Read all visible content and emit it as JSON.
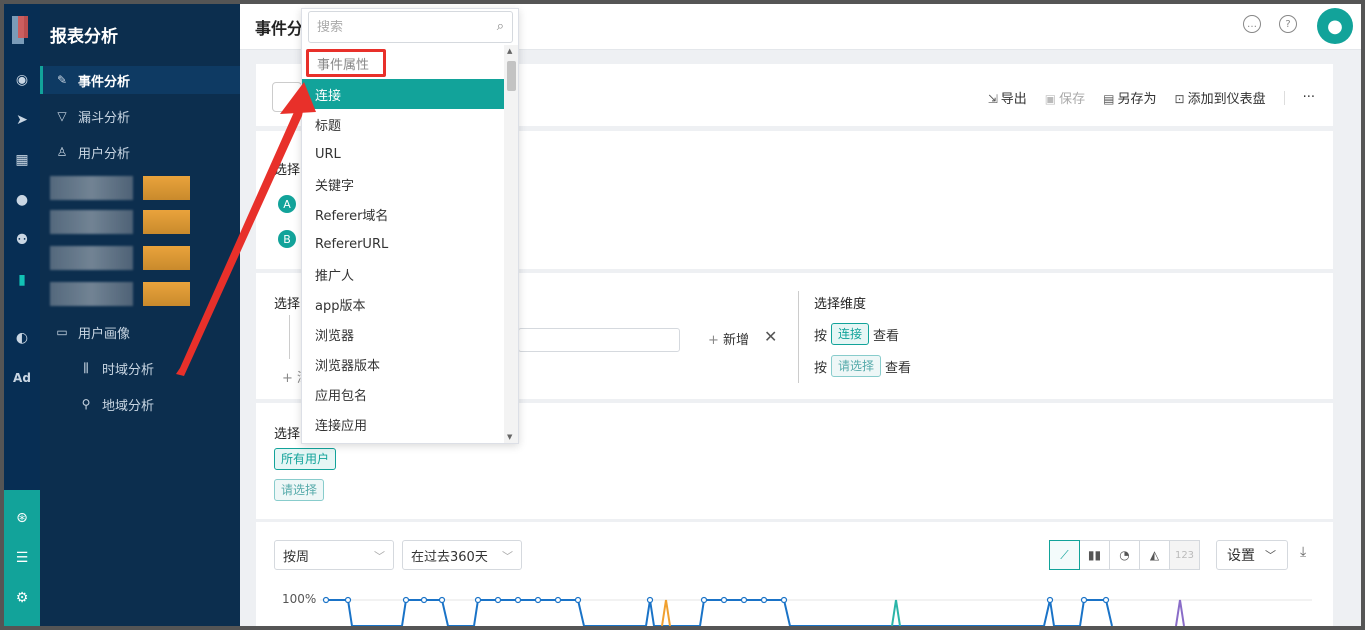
{
  "app": {
    "title": "报表分析",
    "page_title": "事件分"
  },
  "nav": {
    "items": [
      {
        "label": "事件分析",
        "icon": "edit-icon"
      },
      {
        "label": "漏斗分析",
        "icon": "funnel-icon"
      },
      {
        "label": "用户分析",
        "icon": "user-icon"
      },
      {
        "label": "用户画像",
        "icon": "folder-icon"
      },
      {
        "label": "时域分析",
        "icon": "bar-chart-icon"
      },
      {
        "label": "地域分析",
        "icon": "location-icon"
      }
    ]
  },
  "toolbar": {
    "export": "导出",
    "save": "保存",
    "save_as": "另存为",
    "add_dashboard": "添加到仪表盘",
    "more": "···"
  },
  "events": {
    "label": "选择",
    "a": "A",
    "b": "B"
  },
  "filters": {
    "label": "选择",
    "add": "新增",
    "add_more": "+ 添"
  },
  "dimension": {
    "label": "选择维度",
    "rows": [
      {
        "prefix": "按",
        "tag": "连接",
        "suffix": "查看"
      },
      {
        "prefix": "按",
        "tag": "请选择",
        "suffix": "查看"
      }
    ]
  },
  "users": {
    "label": "选择",
    "all_users": "所有用户",
    "please_select": "请选择"
  },
  "chart_controls": {
    "period": "按周",
    "range": "在过去360天",
    "settings": "设置",
    "number_btn": "123"
  },
  "chart_data": {
    "type": "line",
    "y_tick": "100%",
    "series_colors": [
      "#1a73c7",
      "#f0a030",
      "#2bb5a8",
      "#8a6cc8"
    ]
  },
  "dropdown": {
    "search_placeholder": "搜索",
    "group_label": "事件属性",
    "items": [
      "连接",
      "标题",
      "URL",
      "关键字",
      "Referer域名",
      "RefererURL",
      "推广人",
      "app版本",
      "浏览器",
      "浏览器版本",
      "应用包名",
      "连接应用"
    ],
    "selected_index": 0
  },
  "colors": {
    "accent": "#12a39a",
    "nav_bg": "#0c2e4e",
    "rail_bg": "#072e54",
    "highlight": "#e8302a"
  }
}
